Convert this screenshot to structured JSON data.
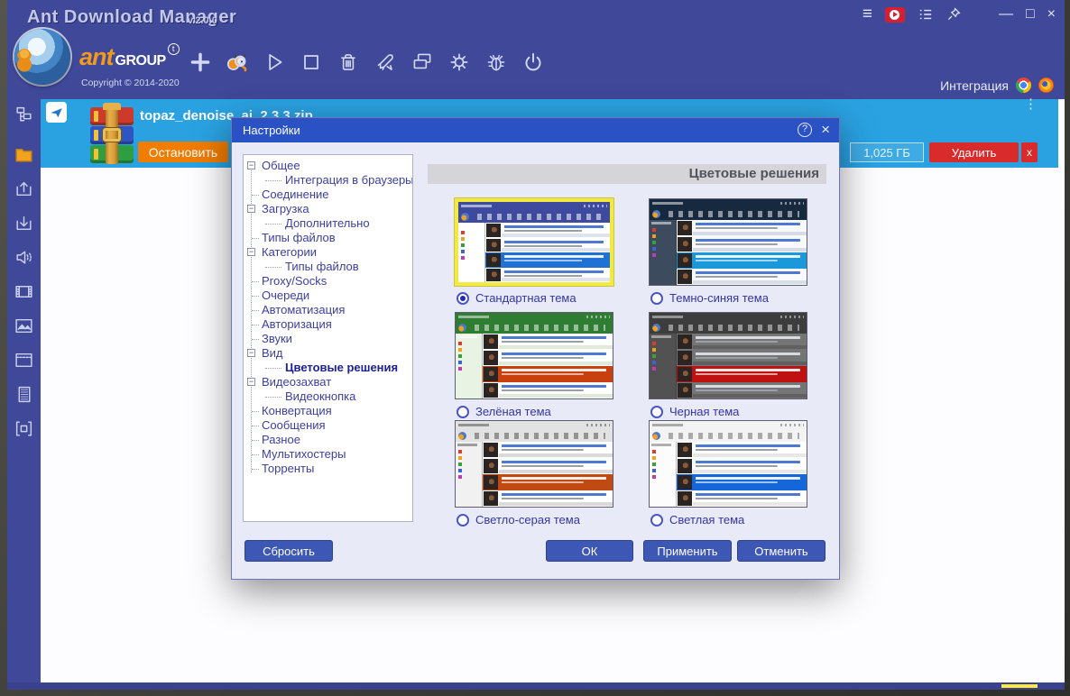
{
  "icons": {
    "menu": "≡",
    "minimize": "—",
    "maximize": "□",
    "close": "×",
    "more": "⋮",
    "help": "?",
    "dialog_close": "×",
    "tm": "t"
  },
  "window": {
    "title": "Ant Download Manager",
    "version": "v.2.0.0",
    "integration_label": "Интеграция",
    "brand": {
      "name": "ant",
      "suffix": "GROUP",
      "copyright": "Copyright © 2014-2020"
    }
  },
  "download": {
    "filename": "topaz_denoise_ai_2.3.3.zip",
    "stop_label": "Остановить",
    "size": "1,025 ГБ",
    "delete_label": "Удалить",
    "close_label": "x"
  },
  "dialog": {
    "title": "Настройки",
    "section_title": "Цветовые решения",
    "tree": [
      {
        "label": "Общее",
        "level": 0,
        "parent": true
      },
      {
        "label": "Интеграция в браузеры",
        "level": 1
      },
      {
        "label": "Соединение",
        "level": 0
      },
      {
        "label": "Загрузка",
        "level": 0,
        "parent": true
      },
      {
        "label": "Дополнительно",
        "level": 1
      },
      {
        "label": "Типы файлов",
        "level": 0
      },
      {
        "label": "Категории",
        "level": 0,
        "parent": true
      },
      {
        "label": "Типы файлов",
        "level": 1
      },
      {
        "label": "Proxy/Socks",
        "level": 0
      },
      {
        "label": "Очереди",
        "level": 0
      },
      {
        "label": "Автоматизация",
        "level": 0
      },
      {
        "label": "Авторизация",
        "level": 0
      },
      {
        "label": "Звуки",
        "level": 0
      },
      {
        "label": "Вид",
        "level": 0,
        "parent": true
      },
      {
        "label": "Цветовые решения",
        "level": 1,
        "selected": true
      },
      {
        "label": "Видеозахват",
        "level": 0,
        "parent": true
      },
      {
        "label": "Видеокнопка",
        "level": 1
      },
      {
        "label": "Конвертация",
        "level": 0
      },
      {
        "label": "Сообщения",
        "level": 0
      },
      {
        "label": "Разное",
        "level": 0
      },
      {
        "label": "Мультихостеры",
        "level": 0
      },
      {
        "label": "Торренты",
        "level": 0
      }
    ],
    "themes": [
      {
        "id": "standard",
        "label": "Стандартная тема",
        "selected": true,
        "colors": {
          "chrome": "#3e4a9e",
          "panel": "#ffffff",
          "rows": "#ffffff",
          "bar": "#dfe3ee",
          "hl": "#1f72d4",
          "link": "#4d7ad0",
          "dash": "rgba(255,255,255,.55)"
        }
      },
      {
        "id": "dark-blue",
        "label": "Темно-синяя тема",
        "selected": false,
        "colors": {
          "chrome": "#16293e",
          "panel": "#3c4c5e",
          "rows": "#f8f9fa",
          "bar": "#d7dde6",
          "hl": "#1b98d8",
          "link": "#4d7ad0",
          "dash": "rgba(255,255,255,.5)"
        }
      },
      {
        "id": "green",
        "label": "Зелёная тема",
        "selected": false,
        "colors": {
          "chrome": "#2f7d33",
          "panel": "#e9f3e3",
          "rows": "#ffffff",
          "bar": "#dfead9",
          "hl": "#c84010",
          "link": "#4d7ad0",
          "dash": "rgba(255,255,255,.5)"
        }
      },
      {
        "id": "black",
        "label": "Черная тема",
        "selected": false,
        "colors": {
          "chrome": "#3d3d3d",
          "panel": "#525252",
          "rows": "#757575",
          "bar": "#606060",
          "hl": "#c01111",
          "link": "#d8dce2",
          "dash": "rgba(255,255,255,.45)"
        }
      },
      {
        "id": "light-gray",
        "label": "Светло-серая тема",
        "selected": false,
        "colors": {
          "chrome": "#e2e2e2",
          "panel": "#f1f1f1",
          "rows": "#ffffff",
          "bar": "#dadada",
          "hl": "#c04a12",
          "link": "#4d7ad0",
          "dash": "rgba(0,0,0,.35)"
        }
      },
      {
        "id": "light",
        "label": "Светлая тема",
        "selected": false,
        "colors": {
          "chrome": "#f3f3f3",
          "panel": "#fcfcfc",
          "rows": "#ffffff",
          "bar": "#e8e8e8",
          "hl": "#1566d8",
          "link": "#4d7ad0",
          "dash": "rgba(0,0,0,.3)"
        }
      }
    ],
    "buttons": {
      "reset": "Сбросить",
      "ok": "ОК",
      "apply": "Применить",
      "cancel": "Отменить"
    }
  },
  "colors": {
    "titlebar": "#3f4899",
    "dialog_titlebar": "#2a52c4",
    "card": "#2aa2e2",
    "button": "#3d57b5",
    "stop": "#f07c00",
    "delete": "#d92b2b",
    "selected_border": "#f2ea3e"
  }
}
